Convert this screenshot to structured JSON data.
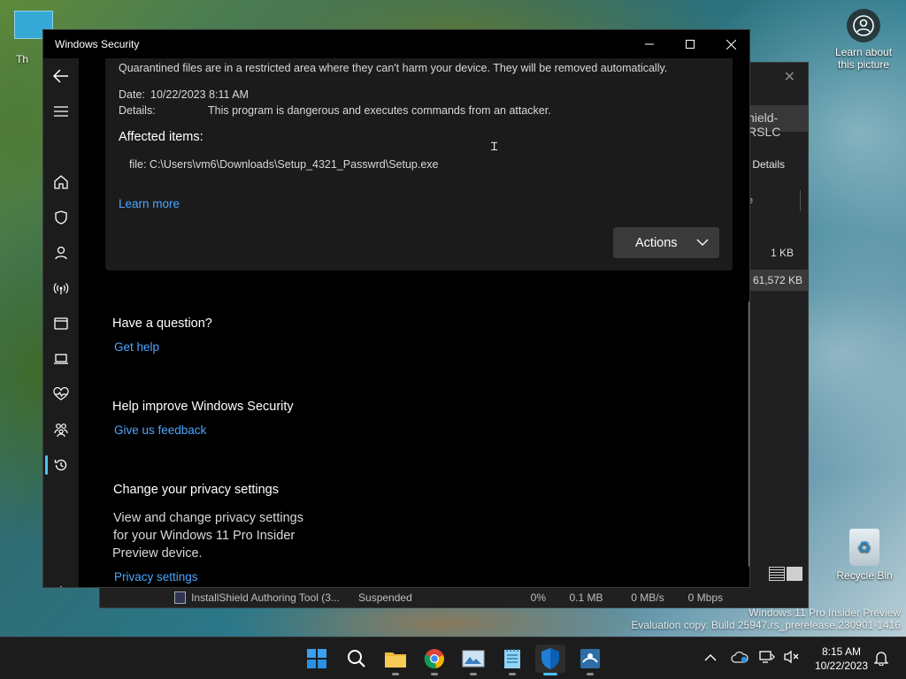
{
  "desktop": {
    "top_left_label": "Th",
    "learn_label": "Learn about this picture",
    "recycle_label": "Recycle Bin",
    "watermark_line1": "Windows 11 Pro Insider Preview",
    "watermark_line2": "Evaluation copy. Build 25947.rs_prerelease.230901-1416"
  },
  "background_window": {
    "title_fragment": "hield-RSLC",
    "details_tab": "Details",
    "column_fragment": "e",
    "row1_size": "1 KB",
    "row2_size": "61,572 KB",
    "status_row": {
      "name": "InstallShield Authoring Tool (3...",
      "status": "Suspended",
      "cpu": "0%",
      "memory": "0.1 MB",
      "disk": "0 MB/s",
      "network": "0 Mbps"
    }
  },
  "window": {
    "title": "Windows Security"
  },
  "sidebar": {
    "items": [
      {
        "id": "back",
        "icon": "back-arrow-icon"
      },
      {
        "id": "menu",
        "icon": "hamburger-menu-icon"
      },
      {
        "id": "home",
        "icon": "home-icon"
      },
      {
        "id": "virus",
        "icon": "shield-icon"
      },
      {
        "id": "account",
        "icon": "person-icon"
      },
      {
        "id": "firewall",
        "icon": "wireless-network-icon"
      },
      {
        "id": "app-browser",
        "icon": "app-window-icon"
      },
      {
        "id": "device-security",
        "icon": "laptop-icon"
      },
      {
        "id": "device-health",
        "icon": "heart-pulse-icon"
      },
      {
        "id": "family",
        "icon": "family-icon"
      },
      {
        "id": "history",
        "icon": "history-icon"
      },
      {
        "id": "settings",
        "icon": "gear-icon"
      }
    ],
    "active": "history"
  },
  "details_card": {
    "quarantine_text": "Quarantined files are in a restricted area where they can't harm your device. They will be removed automatically.",
    "date_label": "Date:",
    "date_value": "10/22/2023 8:11 AM",
    "details_label": "Details:",
    "details_value": "This program is dangerous and executes commands from an attacker.",
    "affected_heading": "Affected items:",
    "affected_item": "file: C:\\Users\\vm6\\Downloads\\Setup_4321_Passwrd\\Setup.exe",
    "learn_more": "Learn more",
    "actions_label": "Actions"
  },
  "sections": {
    "question_heading": "Have a question?",
    "get_help": "Get help",
    "improve_heading": "Help improve Windows Security",
    "feedback": "Give us feedback",
    "privacy_heading": "Change your privacy settings",
    "privacy_line1": "View and change privacy settings",
    "privacy_line2": "for your Windows 11 Pro Insider",
    "privacy_line3": "Preview device.",
    "privacy_link": "Privacy settings"
  },
  "taskbar": {
    "apps": [
      "start-icon",
      "search-icon",
      "file-explorer-icon",
      "chrome-icon",
      "photos-icon",
      "notepad-icon",
      "windows-security-icon",
      "installshield-icon"
    ],
    "time": "8:15 AM",
    "date": "10/22/2023"
  },
  "colors": {
    "accent": "#4cc2ff",
    "link": "#4ca6ff",
    "window_bg": "#000000",
    "card_bg": "#1b1b1b"
  }
}
